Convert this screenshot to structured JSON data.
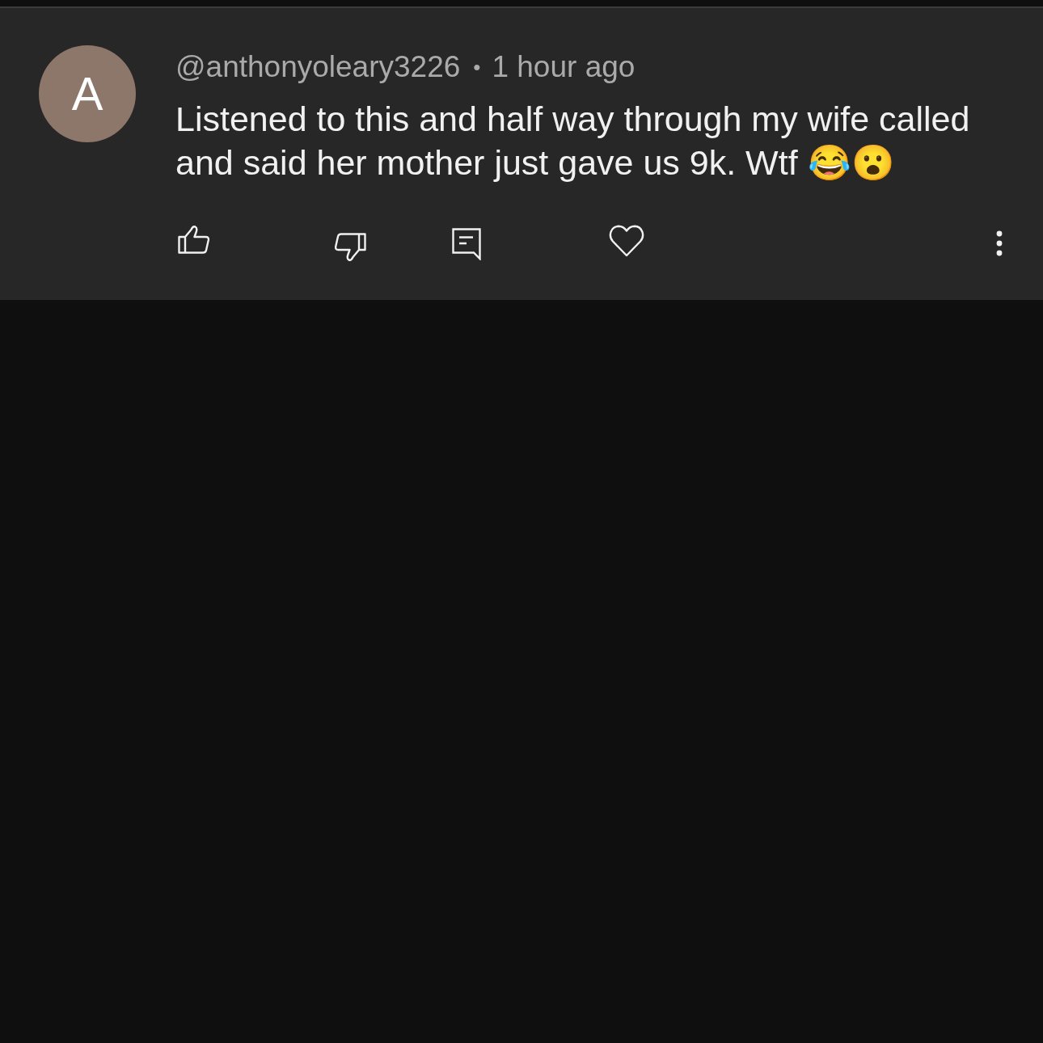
{
  "comment": {
    "avatar": {
      "initial": "A"
    },
    "author": "@anthonyoleary3226",
    "separator": "•",
    "time": "1 hour ago",
    "text": "Listened to this and half way through my wife called and said her mother just gave us 9k. Wtf 😂😮"
  },
  "actions": [
    {
      "kind": "like"
    },
    {
      "kind": "dislike"
    },
    {
      "kind": "reply"
    },
    {
      "kind": "heart"
    },
    {
      "kind": "more"
    }
  ]
}
